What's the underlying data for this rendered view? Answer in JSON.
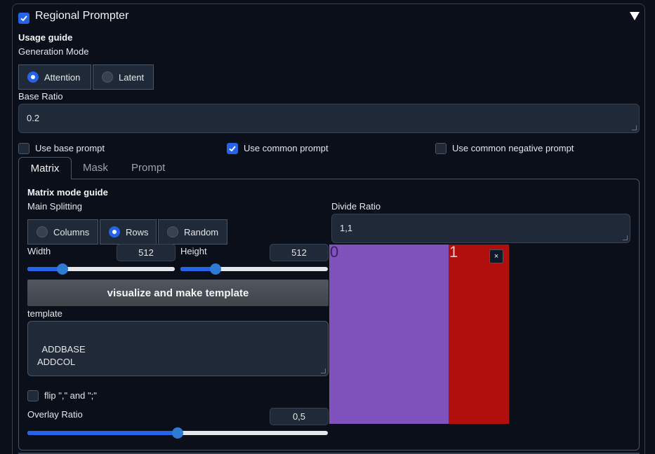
{
  "header": {
    "title": "Regional Prompter",
    "enabled": true
  },
  "usage_guide": "Usage guide",
  "generation_mode": {
    "label": "Generation Mode",
    "options": [
      "Attention",
      "Latent"
    ],
    "selected": "Attention"
  },
  "base_ratio": {
    "label": "Base Ratio",
    "value": "0.2"
  },
  "options": {
    "use_base_prompt": {
      "label": "Use base prompt",
      "checked": false
    },
    "use_common_prompt": {
      "label": "Use common prompt",
      "checked": true
    },
    "use_common_negative_prompt": {
      "label": "Use common negative prompt",
      "checked": false
    }
  },
  "tabs": [
    "Matrix",
    "Mask",
    "Prompt"
  ],
  "active_tab": "Matrix",
  "matrix": {
    "guide": "Matrix mode guide",
    "main_splitting": {
      "label": "Main Splitting",
      "options": [
        "Columns",
        "Rows",
        "Random"
      ],
      "selected": "Rows"
    },
    "divide_ratio": {
      "label": "Divide Ratio",
      "value": "1,1"
    },
    "width": {
      "label": "Width",
      "value": "512",
      "fraction": 0.24
    },
    "height": {
      "label": "Height",
      "value": "512",
      "fraction": 0.24
    },
    "visualize_button": "visualize and make template",
    "template": {
      "label": "template",
      "value": "ADDBASE\nADDCOL"
    },
    "flip": {
      "label": "flip \",\" and \";\"",
      "checked": false
    },
    "overlay_ratio": {
      "label": "Overlay Ratio",
      "value": "0,5",
      "fraction": 0.5
    },
    "preview": {
      "regions": [
        {
          "label": "0",
          "color": "#8052bb",
          "label_color": "#3d1a6b",
          "fraction": 0.664
        },
        {
          "label": "1",
          "color": "#b10e0e",
          "label_color": "#f3c6c6",
          "fraction": 0.336
        }
      ],
      "close_icon": "×"
    }
  },
  "colors": {
    "accent": "#2563eb",
    "background": "#0b0f19",
    "input": "#1f2937"
  }
}
